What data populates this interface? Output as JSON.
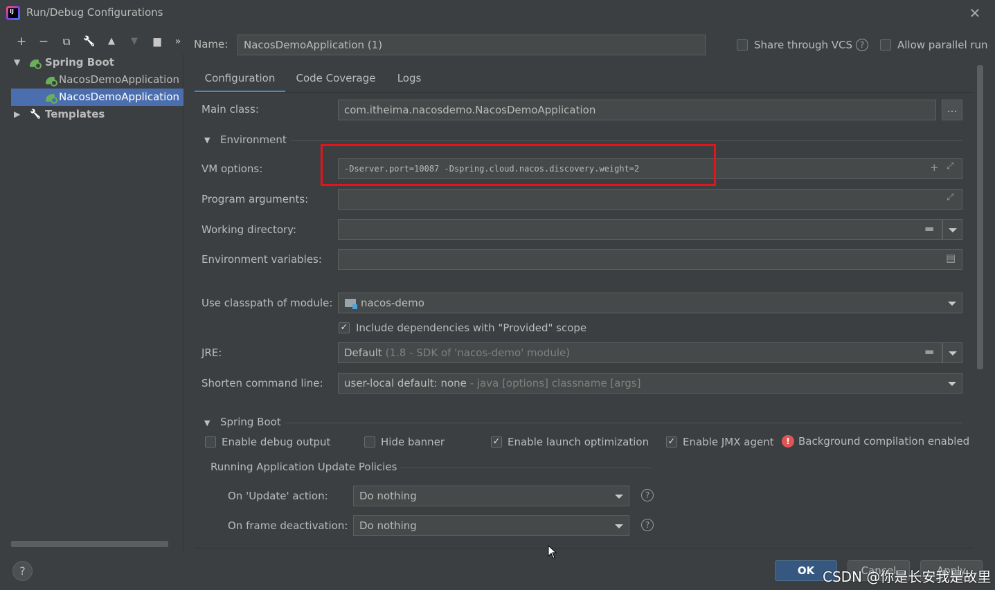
{
  "window": {
    "title": "Run/Debug Configurations",
    "close_icon": "close-icon"
  },
  "toolbar": {
    "icons": [
      "add-icon",
      "remove-icon",
      "copy-icon",
      "wrench-icon",
      "move-up-icon",
      "move-down-icon",
      "new-folder-icon",
      "more-icon"
    ],
    "glyphs": [
      "+",
      "−",
      "⧉",
      "🔧",
      "▲",
      "▼",
      "▆",
      "»"
    ]
  },
  "tree": {
    "spring_boot": "Spring Boot",
    "item1": "NacosDemoApplication",
    "item2": "NacosDemoApplication",
    "templates": "Templates"
  },
  "header": {
    "name_label": "Name:",
    "name_value": "NacosDemoApplication (1)",
    "share_label": "Share through VCS",
    "parallel_label": "Allow parallel run"
  },
  "tabs": [
    "Configuration",
    "Code Coverage",
    "Logs"
  ],
  "form": {
    "main_class_label": "Main class:",
    "main_class_value": "com.itheima.nacosdemo.NacosDemoApplication",
    "browse_label": "...",
    "environment_section": "Environment",
    "vm_options_label": "VM options:",
    "vm_options_value": "-Dserver.port=10087 -Dspring.cloud.nacos.discovery.weight=2",
    "program_args_label": "Program arguments:",
    "working_dir_label": "Working directory:",
    "env_vars_label": "Environment variables:",
    "classpath_label": "Use classpath of module:",
    "classpath_value": "nacos-demo",
    "include_deps_label": "Include dependencies with \"Provided\" scope",
    "jre_label": "JRE:",
    "jre_value": "Default",
    "jre_hint": "(1.8 - SDK of 'nacos-demo' module)",
    "shorten_label": "Shorten command line:",
    "shorten_value": "user-local default: none",
    "shorten_hint": "- java [options] classname [args]"
  },
  "spring_boot": {
    "section": "Spring Boot",
    "debug_output": "Enable debug output",
    "hide_banner": "Hide banner",
    "launch_opt": "Enable launch optimization",
    "jmx": "Enable JMX agent",
    "bg_compile": "Background compilation enabled",
    "policies_title": "Running Application Update Policies",
    "update_label": "On 'Update' action:",
    "update_value": "Do nothing",
    "frame_label": "On frame deactivation:",
    "frame_value": "Do nothing"
  },
  "checkbox_states": {
    "share": false,
    "parallel": false,
    "include_deps": true,
    "debug_output": false,
    "hide_banner": false,
    "launch_opt": true,
    "jmx": true
  },
  "footer": {
    "ok": "OK",
    "cancel": "Cancel",
    "apply": "Apply",
    "help": "?",
    "watermark": "CSDN @你是长安我是故里"
  },
  "colors": {
    "background": "#3c3f41",
    "selection": "#4b6eaf",
    "highlight": "#e3151a",
    "accent": "#4a88c7"
  }
}
